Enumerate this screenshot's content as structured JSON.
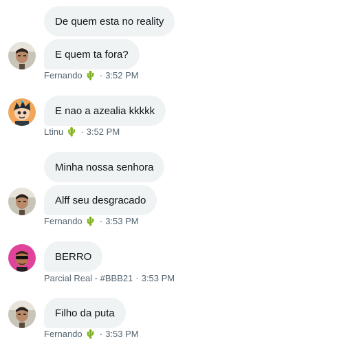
{
  "messages": [
    {
      "sender": "Fernando",
      "badge": "🌵",
      "time": "3:52 PM",
      "avatar": "man-face-avatar",
      "texts": [
        "De quem esta no reality",
        "E quem ta fora?"
      ]
    },
    {
      "sender": "Ltinu",
      "badge": "🌵",
      "time": "3:52 PM",
      "avatar": "cartoon-avatar",
      "texts": [
        "E nao a azealia kkkkk"
      ]
    },
    {
      "sender": "Fernando",
      "badge": "🌵",
      "time": "3:53 PM",
      "avatar": "man-face-avatar",
      "texts": [
        "Minha nossa senhora",
        "Alff seu desgracado"
      ]
    },
    {
      "sender": "Parcial Real - #BBB21",
      "badge": "",
      "time": "3:53 PM",
      "avatar": "sunglasses-avatar",
      "texts": [
        "BERRO"
      ]
    },
    {
      "sender": "Fernando",
      "badge": "🌵",
      "time": "3:53 PM",
      "avatar": "man-face-avatar",
      "texts": [
        "Filho da puta"
      ]
    }
  ],
  "separator": "·",
  "colors": {
    "bubble": "#eff3f4",
    "meta_text": "#536471",
    "text": "#0f1419"
  }
}
